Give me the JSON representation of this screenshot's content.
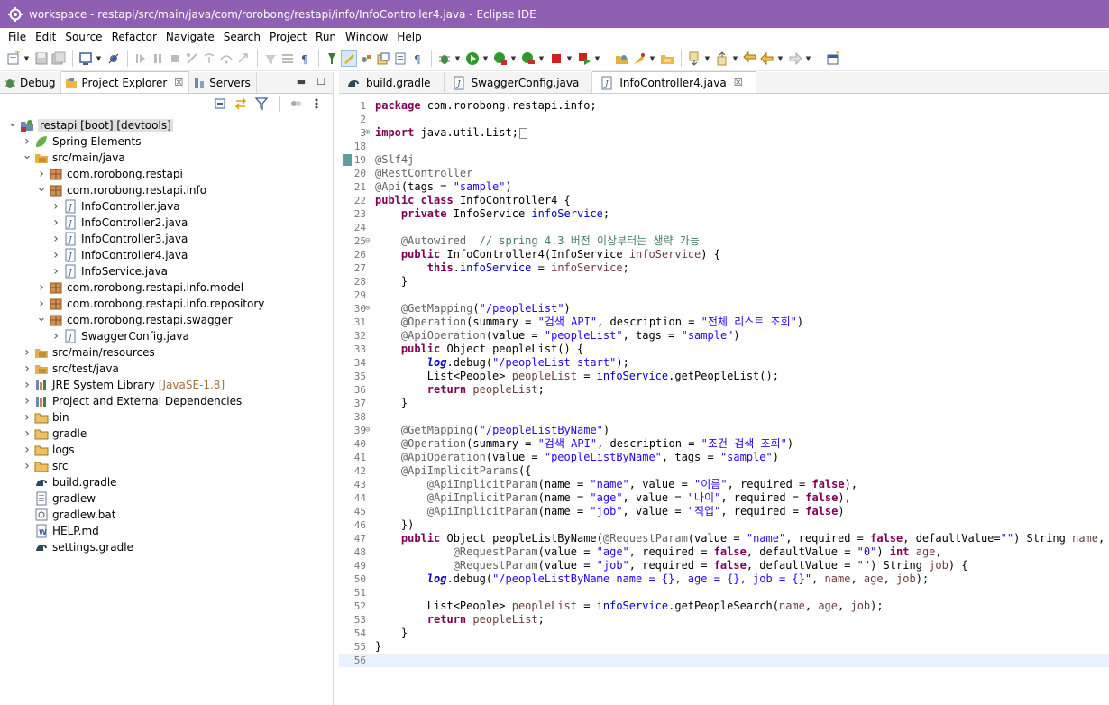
{
  "window": {
    "title": "workspace - restapi/src/main/java/com/rorobong/restapi/info/InfoController4.java - Eclipse IDE"
  },
  "menu": [
    "File",
    "Edit",
    "Source",
    "Refactor",
    "Navigate",
    "Search",
    "Project",
    "Run",
    "Window",
    "Help"
  ],
  "left_view": {
    "tabs": [
      {
        "label": "Debug",
        "icon": "debug-bug-icon"
      },
      {
        "label": "Project Explorer",
        "icon": "project-explorer-icon",
        "close": "☒"
      },
      {
        "label": "Servers",
        "icon": "servers-icon"
      }
    ]
  },
  "tree": [
    {
      "label": "restapi [boot] [devtools]",
      "twisty": "open",
      "icon": "boot-project-icon",
      "selected": true
    },
    {
      "label": "Spring Elements",
      "twisty": "closed",
      "icon": "spring-leaf-icon"
    },
    {
      "label": "src/main/java",
      "twisty": "open",
      "icon": "source-folder-icon"
    },
    {
      "label": "com.rorobong.restapi",
      "twisty": "closed",
      "icon": "package-icon"
    },
    {
      "label": "com.rorobong.restapi.info",
      "twisty": "open",
      "icon": "package-icon"
    },
    {
      "label": "InfoController.java",
      "twisty": "closed",
      "icon": "java-file-icon"
    },
    {
      "label": "InfoController2.java",
      "twisty": "closed",
      "icon": "java-file-icon"
    },
    {
      "label": "InfoController3.java",
      "twisty": "closed",
      "icon": "java-file-icon"
    },
    {
      "label": "InfoController4.java",
      "twisty": "closed",
      "icon": "java-file-icon"
    },
    {
      "label": "InfoService.java",
      "twisty": "closed",
      "icon": "java-file-icon"
    },
    {
      "label": "com.rorobong.restapi.info.model",
      "twisty": "closed",
      "icon": "package-icon"
    },
    {
      "label": "com.rorobong.restapi.info.repository",
      "twisty": "closed",
      "icon": "package-icon"
    },
    {
      "label": "com.rorobong.restapi.swagger",
      "twisty": "open",
      "icon": "package-icon"
    },
    {
      "label": "SwaggerConfig.java",
      "twisty": "closed",
      "icon": "java-file-icon"
    },
    {
      "label": "src/main/resources",
      "twisty": "closed",
      "icon": "source-folder-icon"
    },
    {
      "label": "src/test/java",
      "twisty": "closed",
      "icon": "source-folder-icon"
    },
    {
      "label": "JRE System Library",
      "suffix": "[JavaSE-1.8]",
      "twisty": "closed",
      "icon": "library-icon"
    },
    {
      "label": "Project and External Dependencies",
      "twisty": "closed",
      "icon": "library-icon"
    },
    {
      "label": "bin",
      "twisty": "closed",
      "icon": "folder-icon"
    },
    {
      "label": "gradle",
      "twisty": "closed",
      "icon": "folder-icon"
    },
    {
      "label": "logs",
      "twisty": "closed",
      "icon": "folder-icon"
    },
    {
      "label": "src",
      "twisty": "closed",
      "icon": "folder-icon"
    },
    {
      "label": "build.gradle",
      "twisty": "none",
      "icon": "gradle-file-icon"
    },
    {
      "label": "gradlew",
      "twisty": "none",
      "icon": "text-file-icon"
    },
    {
      "label": "gradlew.bat",
      "twisty": "none",
      "icon": "bat-file-icon"
    },
    {
      "label": "HELP.md",
      "twisty": "none",
      "icon": "markdown-file-icon"
    },
    {
      "label": "settings.gradle",
      "twisty": "none",
      "icon": "gradle-file-icon"
    }
  ],
  "editor": {
    "tabs": [
      {
        "label": "build.gradle",
        "icon": "gradle-file-icon",
        "active": false
      },
      {
        "label": "SwaggerConfig.java",
        "icon": "java-file-icon",
        "active": false
      },
      {
        "label": "InfoController4.java",
        "icon": "java-file-icon",
        "active": true,
        "close": "☒"
      }
    ],
    "lines": [
      {
        "n": "1",
        "html": "<span class=\"k\">package</span> com.rorobong.restapi.info;"
      },
      {
        "n": "2",
        "html": ""
      },
      {
        "n": "3",
        "fold": "⊕",
        "html": "<span class=\"k\">import</span> java.util.List;<span class=\"cursor-box\"></span>"
      },
      {
        "n": "18",
        "html": ""
      },
      {
        "n": "19",
        "html": "<span class=\"a\">@Slf4j</span>",
        "marker": true
      },
      {
        "n": "20",
        "html": "<span class=\"a\">@RestController</span>"
      },
      {
        "n": "21",
        "html": "<span class=\"a\">@Api</span>(tags = <span class=\"s\">\"sample\"</span>)"
      },
      {
        "n": "22",
        "html": "<span class=\"k\">public</span> <span class=\"k\">class</span> InfoController4 {"
      },
      {
        "n": "23",
        "html": "    <span class=\"k\">private</span> InfoService <span class=\"f\">infoService</span>;"
      },
      {
        "n": "24",
        "html": ""
      },
      {
        "n": "25",
        "fold": "⊖",
        "html": "    <span class=\"a\">@Autowired</span>  <span class=\"c\">// spring 4.3 버전 이상부터는 생략 가능</span>"
      },
      {
        "n": "26",
        "html": "    <span class=\"k\">public</span> InfoController4(InfoService <span class=\"p\">infoService</span>) {"
      },
      {
        "n": "27",
        "html": "        <span class=\"k\">this</span>.<span class=\"f\">infoService</span> = <span class=\"p\">infoService</span>;"
      },
      {
        "n": "28",
        "html": "    }"
      },
      {
        "n": "29",
        "html": ""
      },
      {
        "n": "30",
        "fold": "⊖",
        "html": "    <span class=\"a\">@GetMapping</span>(<span class=\"s\">\"/peopleList\"</span>)"
      },
      {
        "n": "31",
        "html": "    <span class=\"a\">@Operation</span>(summary = <span class=\"s\">\"검색 API\"</span>, description = <span class=\"s\">\"전체 리스트 조회\"</span>)"
      },
      {
        "n": "32",
        "html": "    <span class=\"a\">@ApiOperation</span>(value = <span class=\"s\">\"peopleList\"</span>, tags = <span class=\"s\">\"sample\"</span>)"
      },
      {
        "n": "33",
        "html": "    <span class=\"k\">public</span> Object peopleList() {"
      },
      {
        "n": "34",
        "html": "        <span class=\"sf\">log</span>.debug(<span class=\"s\">\"/peopleList start\"</span>);"
      },
      {
        "n": "35",
        "html": "        List&lt;People&gt; <span class=\"p\">peopleList</span> = <span class=\"f\">infoService</span>.getPeopleList();"
      },
      {
        "n": "36",
        "html": "        <span class=\"k\">return</span> <span class=\"p\">peopleList</span>;"
      },
      {
        "n": "37",
        "html": "    }"
      },
      {
        "n": "38",
        "html": ""
      },
      {
        "n": "39",
        "fold": "⊖",
        "html": "    <span class=\"a\">@GetMapping</span>(<span class=\"s\">\"/peopleListByName\"</span>)"
      },
      {
        "n": "40",
        "html": "    <span class=\"a\">@Operation</span>(summary = <span class=\"s\">\"검색 API\"</span>, description = <span class=\"s\">\"조건 검색 조회\"</span>)"
      },
      {
        "n": "41",
        "html": "    <span class=\"a\">@ApiOperation</span>(value = <span class=\"s\">\"peopleListByName\"</span>, tags = <span class=\"s\">\"sample\"</span>)"
      },
      {
        "n": "42",
        "html": "    <span class=\"a\">@ApiImplicitParams</span>({"
      },
      {
        "n": "43",
        "html": "        <span class=\"a\">@ApiImplicitParam</span>(name = <span class=\"s\">\"name\"</span>, value = <span class=\"s\">\"이름\"</span>, required = <span class=\"k\">false</span>),"
      },
      {
        "n": "44",
        "html": "        <span class=\"a\">@ApiImplicitParam</span>(name = <span class=\"s\">\"age\"</span>, value = <span class=\"s\">\"나이\"</span>, required = <span class=\"k\">false</span>),"
      },
      {
        "n": "45",
        "html": "        <span class=\"a\">@ApiImplicitParam</span>(name = <span class=\"s\">\"job\"</span>, value = <span class=\"s\">\"직업\"</span>, required = <span class=\"k\">false</span>)"
      },
      {
        "n": "46",
        "html": "    })"
      },
      {
        "n": "47",
        "html": "    <span class=\"k\">public</span> Object peopleListByName(<span class=\"a\">@RequestParam</span>(value = <span class=\"s\">\"name\"</span>, required = <span class=\"k\">false</span>, defaultValue=<span class=\"s\">\"\"</span>) String <span class=\"p\">name</span>,"
      },
      {
        "n": "48",
        "html": "            <span class=\"a\">@RequestParam</span>(value = <span class=\"s\">\"age\"</span>, required = <span class=\"k\">false</span>, defaultValue = <span class=\"s\">\"0\"</span>) <span class=\"k\">int</span> <span class=\"p\">age</span>,"
      },
      {
        "n": "49",
        "html": "            <span class=\"a\">@RequestParam</span>(value = <span class=\"s\">\"job\"</span>, required = <span class=\"k\">false</span>, defaultValue = <span class=\"s\">\"\"</span>) String <span class=\"p\">job</span>) {"
      },
      {
        "n": "50",
        "html": "        <span class=\"sf\">log</span>.debug(<span class=\"s\">\"/peopleListByName name = {}, age = {}, job = {}\"</span>, <span class=\"p\">name</span>, <span class=\"p\">age</span>, <span class=\"p\">job</span>);"
      },
      {
        "n": "51",
        "html": ""
      },
      {
        "n": "52",
        "html": "        List&lt;People&gt; <span class=\"p\">peopleList</span> = <span class=\"f\">infoService</span>.getPeopleSearch(<span class=\"p\">name</span>, <span class=\"p\">age</span>, <span class=\"p\">job</span>);"
      },
      {
        "n": "53",
        "html": "        <span class=\"k\">return</span> <span class=\"p\">peopleList</span>;"
      },
      {
        "n": "54",
        "html": "    }"
      },
      {
        "n": "55",
        "html": "}"
      },
      {
        "n": "56",
        "html": "",
        "current": true
      }
    ]
  }
}
